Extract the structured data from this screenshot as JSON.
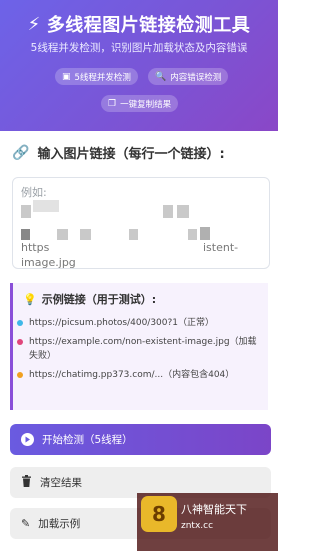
{
  "header": {
    "title": "多线程图片链接检测工具",
    "subtitle": "5线程并发检测，识别图片加载状态及内容错误",
    "badges": [
      {
        "label": "5线程并发检测",
        "icon": "chip-icon"
      },
      {
        "label": "内容错误检测",
        "icon": "search-icon"
      },
      {
        "label": "一键复制结果",
        "icon": "copy-icon"
      }
    ]
  },
  "input_section": {
    "title": "输入图片链接（每行一个链接）:",
    "placeholder_lines": [
      "例如:",
      "https",
      "istent-",
      "image.jpg"
    ]
  },
  "examples": {
    "title": "示例链接（用于测试）:",
    "items": [
      {
        "text": "https://picsum.photos/400/300?1（正常）",
        "color": "#3fb8e8"
      },
      {
        "text": "https://example.com/non-existent-image.jpg（加载失败）",
        "color": "#e0457b"
      },
      {
        "text": "https://chatimg.pp373.com/...（内容包含404）",
        "color": "#f0a020"
      }
    ]
  },
  "buttons": {
    "start": "开始检测（5线程）",
    "clear": "清空结果",
    "load": "加载示例"
  },
  "watermark": {
    "line1": "八神智能天下",
    "line2": "zntx.cc"
  }
}
